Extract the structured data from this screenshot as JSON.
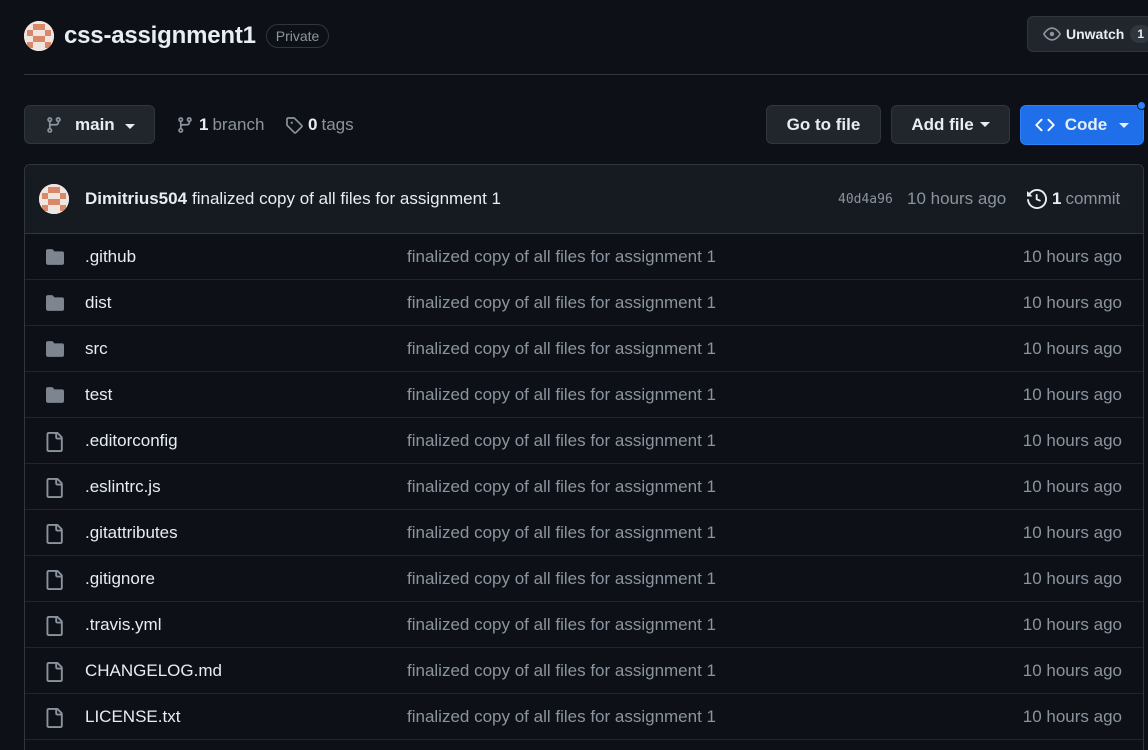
{
  "repo": {
    "name": "css-assignment1",
    "visibility": "Private",
    "unwatch_label": "Unwatch",
    "watch_count": "1"
  },
  "toolbar": {
    "branch": "main",
    "branch_count": "1",
    "branch_label": "branch",
    "tag_count": "0",
    "tag_label": "tags",
    "goto_file_label": "Go to file",
    "add_file_label": "Add file",
    "code_label": "Code"
  },
  "latest_commit": {
    "author": "Dimitrius504",
    "message": "finalized copy of all files for assignment 1",
    "hash": "40d4a96",
    "time": "10 hours ago",
    "count": "1",
    "count_label": "commit"
  },
  "files": [
    {
      "name": ".github",
      "type": "folder",
      "message": "finalized copy of all files for assignment 1",
      "time": "10 hours ago"
    },
    {
      "name": "dist",
      "type": "folder",
      "message": "finalized copy of all files for assignment 1",
      "time": "10 hours ago"
    },
    {
      "name": "src",
      "type": "folder",
      "message": "finalized copy of all files for assignment 1",
      "time": "10 hours ago"
    },
    {
      "name": "test",
      "type": "folder",
      "message": "finalized copy of all files for assignment 1",
      "time": "10 hours ago"
    },
    {
      "name": ".editorconfig",
      "type": "file",
      "message": "finalized copy of all files for assignment 1",
      "time": "10 hours ago"
    },
    {
      "name": ".eslintrc.js",
      "type": "file",
      "message": "finalized copy of all files for assignment 1",
      "time": "10 hours ago"
    },
    {
      "name": ".gitattributes",
      "type": "file",
      "message": "finalized copy of all files for assignment 1",
      "time": "10 hours ago"
    },
    {
      "name": ".gitignore",
      "type": "file",
      "message": "finalized copy of all files for assignment 1",
      "time": "10 hours ago"
    },
    {
      "name": ".travis.yml",
      "type": "file",
      "message": "finalized copy of all files for assignment 1",
      "time": "10 hours ago"
    },
    {
      "name": "CHANGELOG.md",
      "type": "file",
      "message": "finalized copy of all files for assignment 1",
      "time": "10 hours ago"
    },
    {
      "name": "LICENSE.txt",
      "type": "file",
      "message": "finalized copy of all files for assignment 1",
      "time": "10 hours ago"
    }
  ],
  "colors": {
    "background": "#0d1117",
    "accent": "#1f6feb",
    "muted_text": "#8b949e",
    "border": "#30363d"
  }
}
